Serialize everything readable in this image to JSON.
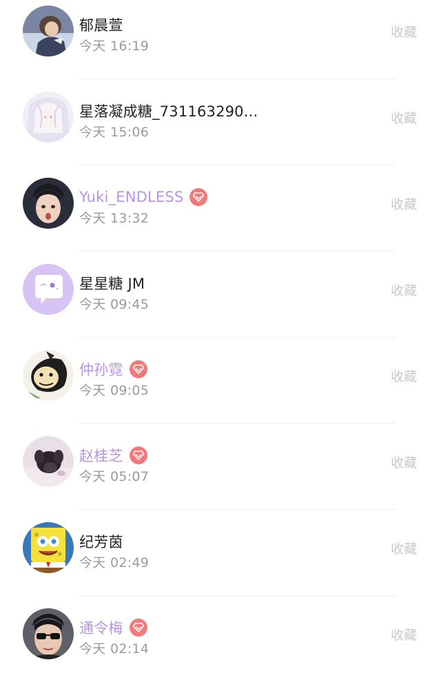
{
  "colors": {
    "name_normal": "#222222",
    "name_vip": "#b893e6",
    "time": "#9a9a9f",
    "favorite": "#c9c9cc",
    "vip_badge": "#f07a7a",
    "separator": "#efeff2"
  },
  "visitors": [
    {
      "name": "郁晨萱",
      "time": "今天 16:19",
      "vip": false,
      "favorite_label": "收藏",
      "avatar_icon": "photo-avatar-girl"
    },
    {
      "name": "星落凝成糖_731163290...",
      "time": "今天 15:06",
      "vip": false,
      "favorite_label": "收藏",
      "avatar_icon": "photo-avatar-anime"
    },
    {
      "name": "Yuki_ENDLESS",
      "time": "今天 13:32",
      "vip": true,
      "favorite_label": "收藏",
      "avatar_icon": "photo-avatar-boy"
    },
    {
      "name": "星星糖 JM",
      "time": "今天 09:45",
      "vip": false,
      "favorite_label": "收藏",
      "avatar_icon": "default-chat-avatar"
    },
    {
      "name": "仲孙霓",
      "time": "今天 09:05",
      "vip": true,
      "favorite_label": "收藏",
      "avatar_icon": "cartoon-avatar-monkey"
    },
    {
      "name": "赵桂芝",
      "time": "今天 05:07",
      "vip": true,
      "favorite_label": "收藏",
      "avatar_icon": "photo-avatar-dog"
    },
    {
      "name": "纪芳茵",
      "time": "今天 02:49",
      "vip": false,
      "favorite_label": "收藏",
      "avatar_icon": "cartoon-avatar-spongebob"
    },
    {
      "name": "通令梅",
      "time": "今天 02:14",
      "vip": true,
      "favorite_label": "收藏",
      "avatar_icon": "photo-avatar-sunglasses"
    }
  ]
}
